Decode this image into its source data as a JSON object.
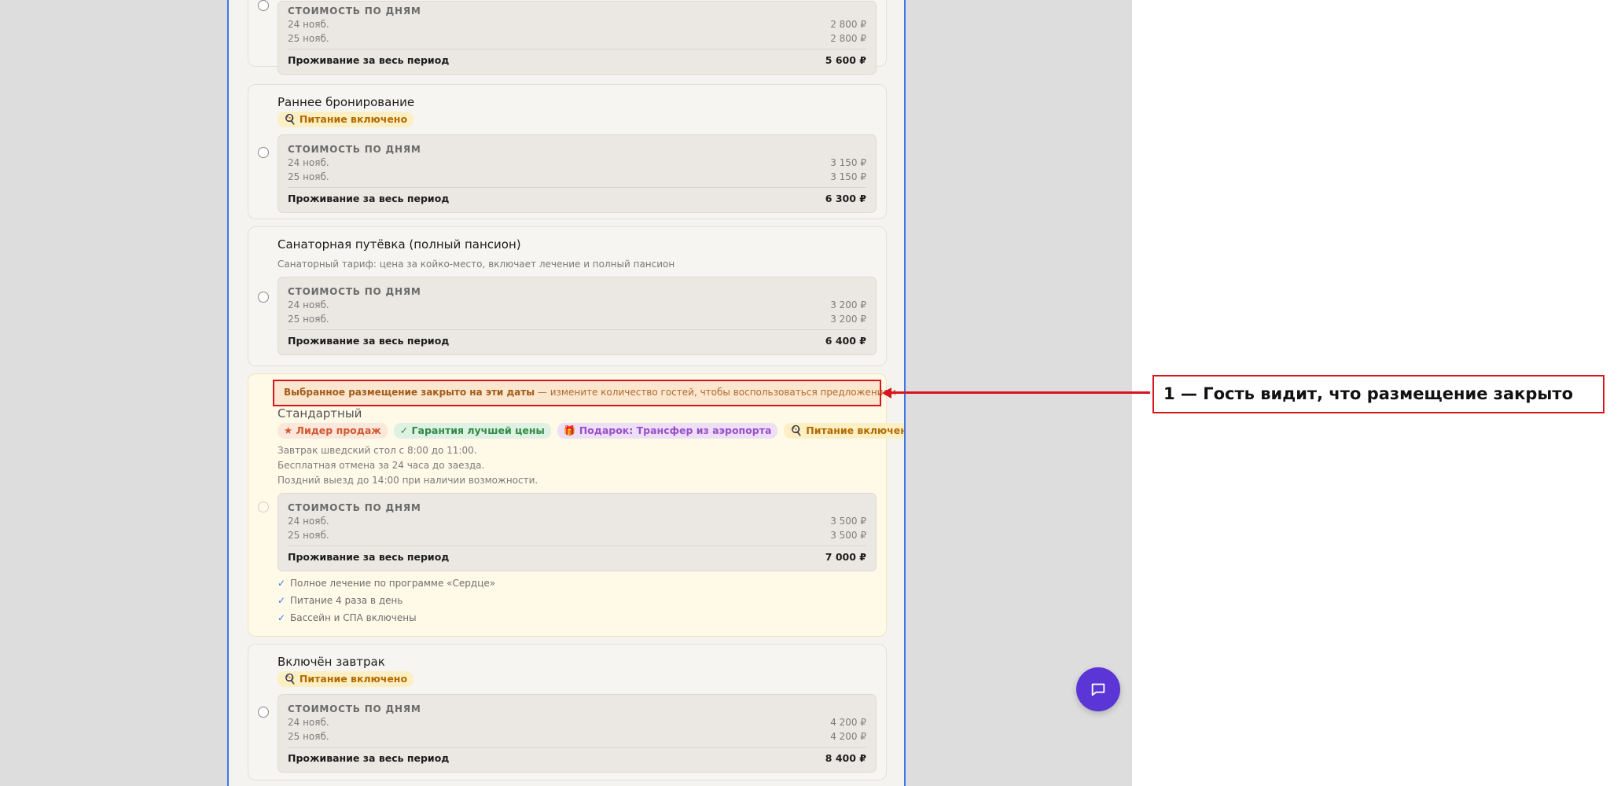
{
  "prices_label": "стоимость по дням",
  "total_label": "Проживание за весь период",
  "tariffs": [
    {
      "title": "",
      "day1": {
        "date": "24 нояб.",
        "price": "2 800 ₽"
      },
      "day2": {
        "date": "25 нояб.",
        "price": "2 800 ₽"
      },
      "total": "5 600 ₽"
    },
    {
      "title": "Раннее бронирование",
      "tag": "🍳 Питание включено",
      "day1": {
        "date": "24 нояб.",
        "price": "3 150 ₽"
      },
      "day2": {
        "date": "25 нояб.",
        "price": "3 150 ₽"
      },
      "total": "6 300 ₽"
    },
    {
      "title": "Санаторная путёвка (полный пансион)",
      "desc": "Санаторный тариф: цена за койко-место, включает лечение и полный пансион",
      "day1": {
        "date": "24 нояб.",
        "price": "3 200 ₽"
      },
      "day2": {
        "date": "25 нояб.",
        "price": "3 200 ₽"
      },
      "total": "6 400 ₽"
    },
    {
      "title": "Стандартный",
      "warning_strong": "Выбранное размещение закрыто на эти даты",
      "warning_rest": "— измените количество гостей, чтобы воспользоваться предложением",
      "tags": [
        "★ Лидер продаж",
        "✓ Гарантия лучшей цены",
        "🎁 Подарок: Трансфер из аэропорта",
        "🍳 Питание включено"
      ],
      "desc_lines": [
        "Завтрак шведский стол с 8:00 до 11:00.",
        "Бесплатная отмена за 24 часа до заезда.",
        "Поздний выезд до 14:00 при наличии возможности."
      ],
      "day1": {
        "date": "24 нояб.",
        "price": "3 500 ₽"
      },
      "day2": {
        "date": "25 нояб.",
        "price": "3 500 ₽"
      },
      "total": "7 000 ₽",
      "check_mark": "✓",
      "features": [
        "Полное лечение по программе «Сердце»",
        "Питание 4 раза в день",
        "Бассейн и СПА включены"
      ]
    },
    {
      "title": "Включён завтрак",
      "tag": "🍳 Питание включено",
      "day1": {
        "date": "24 нояб.",
        "price": "4 200 ₽"
      },
      "day2": {
        "date": "25 нояб.",
        "price": "4 200 ₽"
      },
      "total": "8 400 ₽"
    }
  ],
  "callout_text": "1 — Гость видит, что размещение закрыто",
  "icons": {
    "chat": "chat-bubble-icon"
  },
  "colors": {
    "accent": "#3b78e7",
    "annotation": "#d8141e",
    "chat_button": "#5b35d6"
  }
}
